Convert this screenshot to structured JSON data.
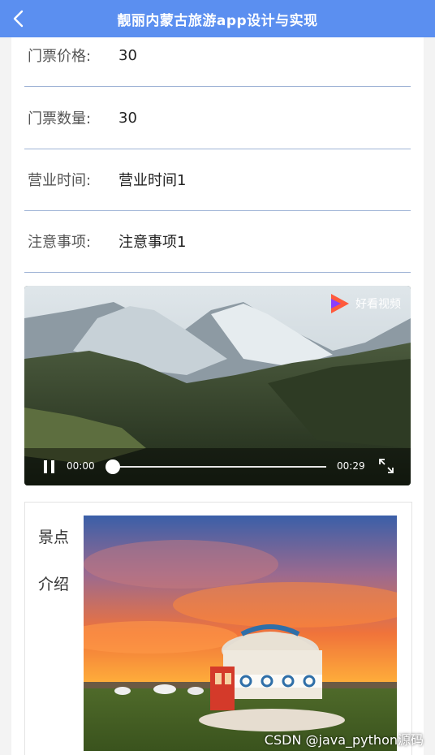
{
  "header": {
    "title": "靓丽内蒙古旅游app设计与实现"
  },
  "details": [
    {
      "label": "门票价格:",
      "value": "30"
    },
    {
      "label": "门票数量:",
      "value": "30"
    },
    {
      "label": "营业时间:",
      "value": "营业时间1"
    },
    {
      "label": "注意事项:",
      "value": "注意事项1"
    }
  ],
  "video": {
    "watermark": "好看视频",
    "current_time": "00:00",
    "duration": "00:29",
    "progress": 0
  },
  "intro": {
    "label_line1": "景点",
    "label_line2": "介绍"
  },
  "watermark": "CSDN @java_python源码",
  "colors": {
    "header": "#5b8ff0",
    "divider": "#9fb4d6"
  }
}
